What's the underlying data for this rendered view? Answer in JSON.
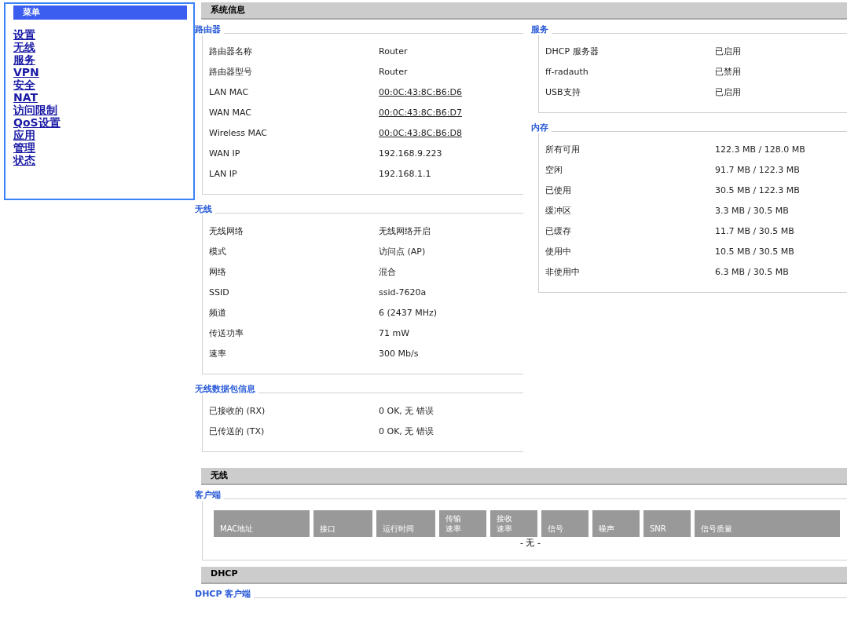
{
  "menu": {
    "title": "菜单",
    "items": [
      "设置",
      "无线",
      "服务",
      "VPN",
      "安全",
      "NAT",
      "访问限制",
      "QoS设置",
      "应用",
      "管理",
      "状态"
    ]
  },
  "sections": [
    {
      "title": "系统信息",
      "columns": [
        [
          {
            "legend": "路由器",
            "rows": [
              {
                "label": "路由器名称",
                "value": "Router",
                "link": false
              },
              {
                "label": "路由器型号",
                "value": "Router",
                "link": false
              },
              {
                "label": "LAN MAC",
                "value": "00:0C:43:8C:B6:D6",
                "link": true
              },
              {
                "label": "WAN MAC",
                "value": "00:0C:43:8C:B6:D7",
                "link": true
              },
              {
                "label": "Wireless MAC",
                "value": "00:0C:43:8C:B6:D8",
                "link": true
              },
              {
                "label": "WAN IP",
                "value": "192.168.9.223",
                "link": false
              },
              {
                "label": "LAN IP",
                "value": "192.168.1.1",
                "link": false
              }
            ]
          },
          {
            "legend": "无线",
            "rows": [
              {
                "label": "无线网络",
                "value": "无线网络开启",
                "link": false
              },
              {
                "label": "模式",
                "value": "访问点 (AP)",
                "link": false
              },
              {
                "label": "网络",
                "value": "混合",
                "link": false
              },
              {
                "label": "SSID",
                "value": "ssid-7620a",
                "link": false
              },
              {
                "label": "频道",
                "value": "6 (2437 MHz)",
                "link": false
              },
              {
                "label": "传送功率",
                "value": "71 mW",
                "link": false
              },
              {
                "label": "速率",
                "value": "300 Mb/s",
                "link": false
              }
            ]
          },
          {
            "legend": "无线数据包信息",
            "rows": [
              {
                "label": "已接收的 (RX)",
                "value": "0 OK, 无 错误",
                "link": false
              },
              {
                "label": "已传送的 (TX)",
                "value": "0 OK, 无 错误",
                "link": false
              }
            ]
          }
        ],
        [
          {
            "legend": "服务",
            "rows": [
              {
                "label": "DHCP 服务器",
                "value": "已启用",
                "link": false
              },
              {
                "label": "ff-radauth",
                "value": "已禁用",
                "link": false
              },
              {
                "label": "USB支持",
                "value": "已启用",
                "link": false
              }
            ]
          },
          {
            "legend": "内存",
            "rows": [
              {
                "label": "所有可用",
                "value": "122.3 MB / 128.0 MB",
                "link": false
              },
              {
                "label": "空闲",
                "value": "91.7 MB / 122.3 MB",
                "link": false
              },
              {
                "label": "已使用",
                "value": "30.5 MB / 122.3 MB",
                "link": false
              },
              {
                "label": "缓冲区",
                "value": "3.3 MB / 30.5 MB",
                "link": false
              },
              {
                "label": "已缓存",
                "value": "11.7 MB / 30.5 MB",
                "link": false
              },
              {
                "label": "使用中",
                "value": "10.5 MB / 30.5 MB",
                "link": false
              },
              {
                "label": "非使用中",
                "value": "6.3 MB / 30.5 MB",
                "link": false
              }
            ]
          }
        ]
      ]
    },
    {
      "title": "无线",
      "table": {
        "legend": "客户端",
        "columns": [
          [
            "MAC地址"
          ],
          [
            "接口"
          ],
          [
            "运行时间"
          ],
          [
            "传输",
            "速率"
          ],
          [
            "接收",
            "速率"
          ],
          [
            "信号"
          ],
          [
            "噪声"
          ],
          [
            "SNR"
          ],
          [
            "信号质量"
          ]
        ],
        "empty": "- 无 -"
      }
    },
    {
      "title": "DHCP",
      "legend_only": "DHCP 客户端"
    }
  ]
}
